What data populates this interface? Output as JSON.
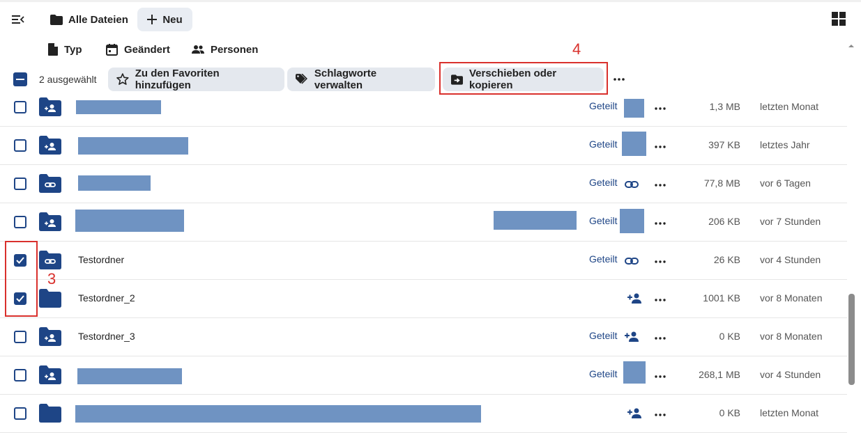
{
  "header": {
    "breadcrumb": "Alle Dateien",
    "new_button": "Neu",
    "menu_icon": "menu-collapse-icon",
    "view_icon": "grid-view-icon"
  },
  "filters": [
    {
      "label": "Typ",
      "icon": "file-icon"
    },
    {
      "label": "Geändert",
      "icon": "calendar-icon"
    },
    {
      "label": "Personen",
      "icon": "people-icon"
    }
  ],
  "selection_bar": {
    "count": "2 ausgewählt",
    "favorites_label": "Zu den Favoriten hinzufügen",
    "tags_label": "Schlagworte verwalten",
    "move_label": "Verschieben oder kopieren"
  },
  "annotations": {
    "step_3": "3",
    "step_4": "4"
  },
  "colors": {
    "accent": "#1e4586",
    "redaction": "#6f93c2",
    "annotation": "#d9302c"
  },
  "files": [
    {
      "name": "",
      "shared": "Geteilt",
      "share_icon": "redacted",
      "size": "1,3 MB",
      "modified": "letzten Monat",
      "checked": false,
      "folder_icon": "shared-folder-icon"
    },
    {
      "name": "",
      "shared": "Geteilt",
      "share_icon": "redacted",
      "size": "397 KB",
      "modified": "letztes Jahr",
      "checked": false,
      "folder_icon": "shared-folder-icon"
    },
    {
      "name": "",
      "shared": "Geteilt",
      "share_icon": "link-icon",
      "size": "77,8 MB",
      "modified": "vor 6 Tagen",
      "checked": false,
      "folder_icon": "link-folder-icon"
    },
    {
      "name": "",
      "shared": "Geteilt",
      "share_icon": "redacted",
      "size": "206 KB",
      "modified": "vor 7 Stunden",
      "checked": false,
      "folder_icon": "shared-folder-icon"
    },
    {
      "name": "Testordner",
      "shared": "Geteilt",
      "share_icon": "link-icon",
      "size": "26 KB",
      "modified": "vor 4 Stunden",
      "checked": true,
      "folder_icon": "link-folder-icon"
    },
    {
      "name": "Testordner_2",
      "shared": "",
      "share_icon": "add-person-icon",
      "size": "1001 KB",
      "modified": "vor 8 Monaten",
      "checked": true,
      "folder_icon": "folder-icon"
    },
    {
      "name": "Testordner_3",
      "shared": "Geteilt",
      "share_icon": "add-person-icon",
      "size": "0 KB",
      "modified": "vor 8 Monaten",
      "checked": false,
      "folder_icon": "shared-folder-icon"
    },
    {
      "name": "",
      "shared": "Geteilt",
      "share_icon": "redacted",
      "size": "268,1 MB",
      "modified": "vor 4 Stunden",
      "checked": false,
      "folder_icon": "shared-folder-icon"
    },
    {
      "name": "",
      "shared": "",
      "share_icon": "add-person-icon",
      "size": "0 KB",
      "modified": "letzten Monat",
      "checked": false,
      "folder_icon": "folder-icon"
    }
  ]
}
